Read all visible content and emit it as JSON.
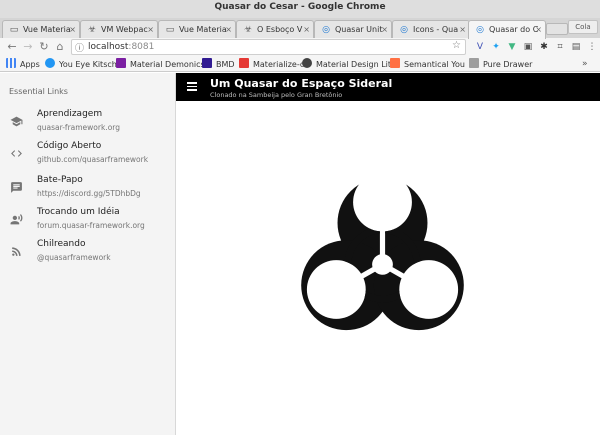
{
  "window": {
    "title": "Quasar do Cesar - Google Chrome"
  },
  "tabs": [
    {
      "label": "Vue Materia",
      "icon": "page-icon",
      "active": false
    },
    {
      "label": "VM Webpac",
      "icon": "biohazard-icon",
      "active": false
    },
    {
      "label": "Vue Materia",
      "icon": "page-icon",
      "active": false
    },
    {
      "label": "O Esboço V",
      "icon": "biohazard-icon",
      "active": false
    },
    {
      "label": "Quasar Unit",
      "icon": "quasar-icon",
      "active": false
    },
    {
      "label": "Icons - Qua",
      "icon": "quasar-icon",
      "active": false
    },
    {
      "label": "Quasar do C",
      "icon": "quasar-icon",
      "active": true
    }
  ],
  "profile": {
    "label": "Cola"
  },
  "address": {
    "host": "localhost",
    "port": ":8081"
  },
  "bookmarks": [
    {
      "label": "Apps",
      "color": "#4285f4"
    },
    {
      "label": "You Eye Kitsch",
      "color": "#2196f3"
    },
    {
      "label": "Material Demonics",
      "color": "#7b1fa2"
    },
    {
      "label": "BMD",
      "color": "#311b92"
    },
    {
      "label": "Materialize-o",
      "color": "#e53935"
    },
    {
      "label": "Material Design Lit",
      "color": "#424242"
    },
    {
      "label": "Semantical You",
      "color": "#ff7043"
    },
    {
      "label": "Pure Drawer",
      "color": "#9e9e9e"
    }
  ],
  "bookmarks_overflow": "»",
  "sidebar": {
    "header": "Essential Links",
    "items": [
      {
        "label": "Aprendizagem",
        "sub": "quasar-framework.org",
        "icon": "school-icon"
      },
      {
        "label": "Código Aberto",
        "sub": "github.com/quasarframework",
        "icon": "code-icon"
      },
      {
        "label": "Bate-Papo",
        "sub": "https://discord.gg/5TDhbDg",
        "icon": "chat-icon"
      },
      {
        "label": "Trocando um Idéia",
        "sub": "forum.quasar-framework.org",
        "icon": "record-voice-icon"
      },
      {
        "label": "Chilreando",
        "sub": "@quasarframework",
        "icon": "rss-feed-icon"
      }
    ]
  },
  "header": {
    "title": "Um Quasar do Espaço Sideral",
    "subtitle": "Clonado na Sambeija pelo Gran Bretônio"
  },
  "colors": {
    "appbar": "#000000",
    "sidebar": "#f4f4f4"
  }
}
